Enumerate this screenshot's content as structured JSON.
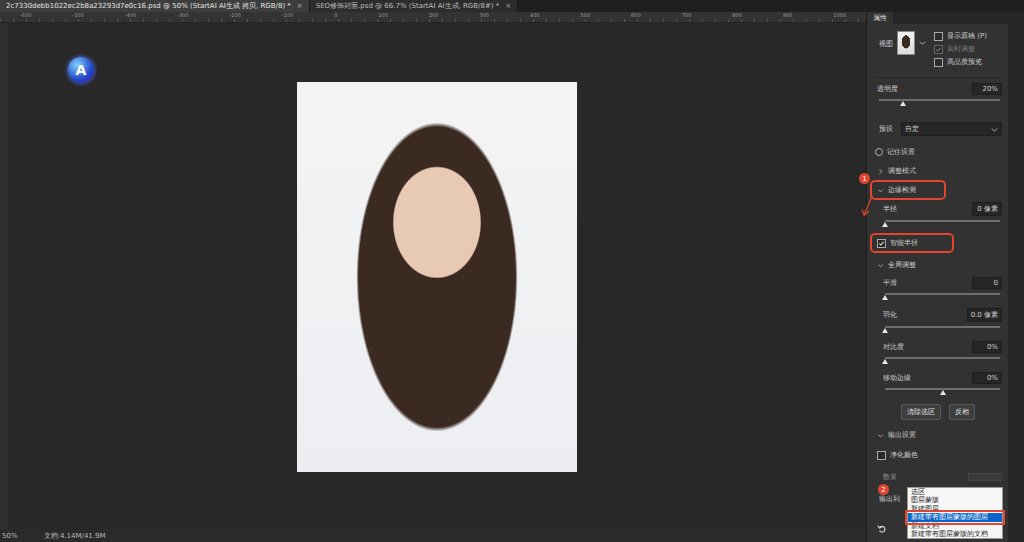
{
  "logo": {
    "letter": "A"
  },
  "tabs": [
    {
      "label": "2c7330debb1022ec2b8a23293d7e0c16.psd @ 50% (StartAI AI生成 拷贝, RGB/8) *",
      "close": "×",
      "selected": true
    },
    {
      "label": "SEO修饰封面.psd @ 66.7% (StartAI AI生成, RGB/8#) *",
      "close": "×",
      "selected": false
    }
  ],
  "ruler": [
    "-600",
    "-500",
    "-400",
    "-300",
    "-200",
    "-100",
    "0",
    "100",
    "200",
    "300",
    "400",
    "500",
    "600",
    "700",
    "800",
    "900",
    "1000"
  ],
  "panel": {
    "title": "属性",
    "view": {
      "label": "视图",
      "options": [
        {
          "label": "显示原稿 (P)",
          "checked": false,
          "disabled": false
        },
        {
          "label": "实时调整",
          "checked": true,
          "disabled": true
        },
        {
          "label": "高品质预览",
          "checked": false,
          "disabled": false
        }
      ]
    },
    "opacity": {
      "label": "透明度",
      "value": "20%",
      "level": 0.2
    },
    "preset": {
      "label": "预设",
      "value": "自定"
    },
    "remember": {
      "label": "记住设置",
      "checked": false
    },
    "sections": [
      {
        "title": "调整模式",
        "expanded": false,
        "highlighted": false,
        "controls": []
      },
      {
        "title": "边缘检测",
        "expanded": true,
        "highlighted": true,
        "annotation": "1",
        "controls": [
          {
            "kind": "slider",
            "label": "半径",
            "value": "0 像素",
            "level": 0,
            "disabled": false
          },
          {
            "kind": "checkbox",
            "label": "智能半径",
            "checked": true,
            "highlighted": true
          }
        ]
      },
      {
        "title": "全局调整",
        "expanded": true,
        "highlighted": false,
        "controls": [
          {
            "kind": "slider",
            "label": "平滑",
            "value": "0",
            "level": 0,
            "disabled": false
          },
          {
            "kind": "slider",
            "label": "羽化",
            "value": "0.0 像素",
            "level": 0,
            "disabled": false
          },
          {
            "kind": "slider",
            "label": "对比度",
            "value": "0%",
            "level": 0,
            "disabled": false
          },
          {
            "kind": "slider",
            "label": "移动边缘",
            "value": "0%",
            "level": 0.5,
            "disabled": false
          },
          {
            "kind": "buttons",
            "labels": [
              "清除选区",
              "反相"
            ]
          }
        ]
      },
      {
        "title": "输出设置",
        "expanded": true,
        "highlighted": false,
        "controls": [
          {
            "kind": "checkbox",
            "label": "净化颜色",
            "checked": false,
            "highlighted": false
          },
          {
            "kind": "field",
            "label": "数量",
            "value": "",
            "disabled": true
          }
        ]
      }
    ],
    "output": {
      "label": "输出到",
      "annotation": "2",
      "options": [
        {
          "label": "选区",
          "selected": false
        },
        {
          "label": "图层蒙版",
          "selected": false
        },
        {
          "label": "新建图层",
          "selected": false
        },
        {
          "label": "新建带有图层蒙版的图层",
          "selected": true
        },
        {
          "label": "新建文档",
          "selected": false
        },
        {
          "label": "新建带有图层蒙版的文档",
          "selected": false
        }
      ]
    }
  },
  "status": {
    "zoom": "50%",
    "doc": "文档:4.14M/41.9M"
  }
}
